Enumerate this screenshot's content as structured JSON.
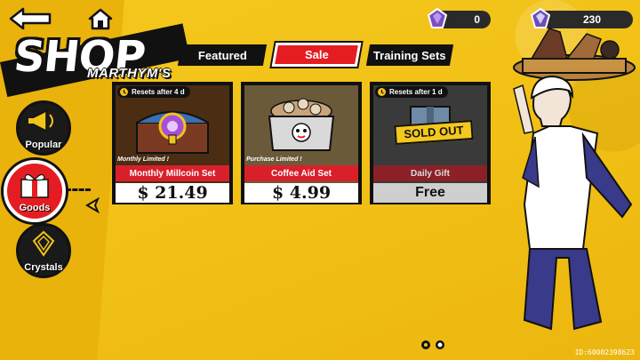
{
  "shop": {
    "title": "SHOP",
    "subtitle": "MARTHYM'S"
  },
  "currency": {
    "primary": {
      "icon": "purple-crystal-icon",
      "value": "0"
    },
    "secondary": {
      "icon": "silver-crystal-icon",
      "value": "230"
    }
  },
  "side_nav": {
    "items": [
      {
        "label": "Popular",
        "icon": "megaphone-icon"
      },
      {
        "label": "Goods",
        "icon": "gift-box-icon",
        "selected": true
      },
      {
        "label": "Crystals",
        "icon": "crystal-icon"
      }
    ]
  },
  "tabs": [
    {
      "label": "Featured"
    },
    {
      "label": "Sale",
      "active": true
    },
    {
      "label": "Training Sets"
    }
  ],
  "cards": [
    {
      "reset": "Resets after  4 d",
      "limit": "Monthly Limited !",
      "name": "Monthly Millcoin Set",
      "price": "$ 21.49",
      "art": "treasure-chest-image"
    },
    {
      "reset": "",
      "limit": "Purchase Limited !",
      "name": "Coffee Aid Set",
      "price": "$ 4.99",
      "art": "coffee-box-image"
    },
    {
      "reset": "Resets after  1 d",
      "limit": "",
      "name": "Daily Gift",
      "price": "Free",
      "sold_out": "SOLD OUT",
      "art": "gift-box-sold-out-image"
    }
  ],
  "player_id": "ID:60002398623",
  "colors": {
    "background": "#f2c318",
    "accent_red": "#e51d22",
    "dark": "#111111"
  }
}
